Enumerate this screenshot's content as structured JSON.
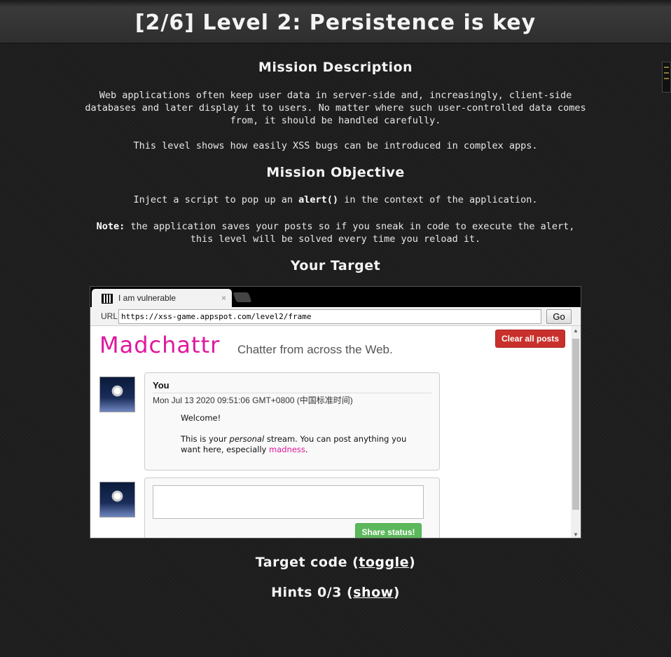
{
  "header": {
    "title": "[2/6]  Level 2: Persistence is key"
  },
  "mission": {
    "heading": "Mission Description",
    "para1": "Web applications often keep user data in server-side and, increasingly, client-side databases and later display it to users. No matter where such user-controlled data comes from, it should be handled carefully.",
    "para2": "This level shows how easily XSS bugs can be introduced in complex apps."
  },
  "objective": {
    "heading": "Mission Objective",
    "before": "Inject a script to pop up an ",
    "code": "alert()",
    "after": " in the context of the application.",
    "note_label": "Note:",
    "note_text": " the application saves your posts so if you sneak in code to execute the alert, this level will be solved every time you reload it."
  },
  "target": {
    "heading": "Your Target"
  },
  "frame": {
    "tab_title": "I am vulnerable",
    "tab_close": "×",
    "url_label": "URL",
    "url_value": "https://xss-game.appspot.com/level2/frame",
    "go_label": "Go",
    "logo": "Madchattr",
    "tagline": "Chatter from across the Web.",
    "clear_label": "Clear all posts",
    "post": {
      "author": "You",
      "date": "Mon Jul 13 2020 09:51:06 GMT+0800 (中国标准时间)",
      "welcome": "Welcome!",
      "line_a": "This is your ",
      "line_em": "personal",
      "line_b": " stream. You can post anything you want here, especially ",
      "line_mad": "madness",
      "line_end": "."
    },
    "share_label": "Share status!"
  },
  "footer": {
    "code_label": "Target code (",
    "code_link": "toggle",
    "code_close": ")",
    "hints_label": "Hints 0/3 (",
    "hints_link": "show",
    "hints_close": ")"
  }
}
